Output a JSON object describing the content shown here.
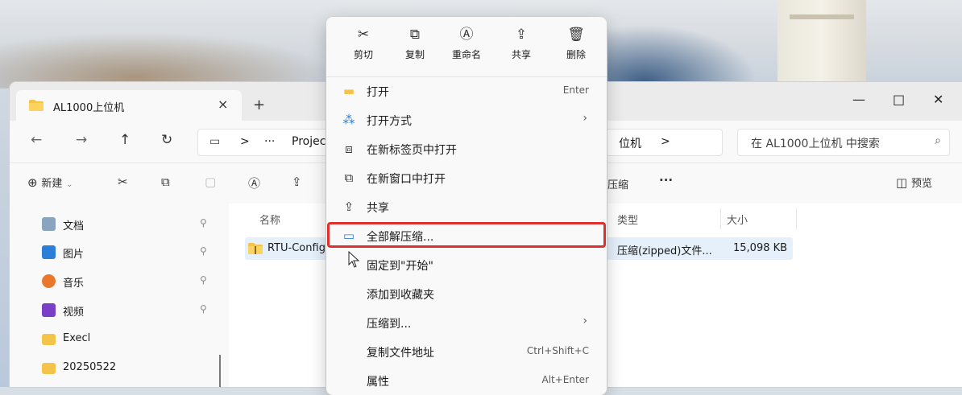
{
  "window": {
    "tab_title": "AL1000上位机",
    "tab_close": "×",
    "tab_add": "+",
    "minimize": "—",
    "maximize": "□",
    "close": "✕"
  },
  "address": {
    "back": "←",
    "forward": "→",
    "up": "↑",
    "refresh": "↻",
    "monitor": "▭",
    "sep": ">",
    "ellipsis": "···",
    "path_part1": "Projec",
    "path_part2": "位机",
    "path_sep2": ">",
    "search_placeholder": "在 AL1000上位机 中搜索",
    "search_icon": "⌕"
  },
  "toolbar": {
    "new_icon": "⊕",
    "new_label": "新建",
    "new_chevron": "⌄",
    "cut_icon": "✂",
    "copy_icon": "⧉",
    "paste_icon": "▢",
    "rename_icon": "Ⓐ",
    "share_icon": "⇪",
    "compress_label": "压缩",
    "more": "···",
    "preview_icon": "◫",
    "preview_label": "预览"
  },
  "sidebar": {
    "items": [
      {
        "label": "文档",
        "pin": "⚲"
      },
      {
        "label": "图片",
        "pin": "⚲"
      },
      {
        "label": "音乐",
        "pin": "⚲"
      },
      {
        "label": "视频",
        "pin": "⚲"
      },
      {
        "label": "Execl"
      },
      {
        "label": "20250522"
      }
    ]
  },
  "content": {
    "col_name": "名称",
    "col_type": "类型",
    "col_size": "大小",
    "file_name": "RTU-Config",
    "file_type": "压缩(zipped)文件...",
    "file_size": "15,098 KB"
  },
  "context_menu": {
    "quick_actions": [
      {
        "icon": "✂",
        "label": "剪切"
      },
      {
        "icon": "⧉",
        "label": "复制"
      },
      {
        "icon": "Ⓐ",
        "label": "重命名"
      },
      {
        "icon": "⇪",
        "label": "共享"
      },
      {
        "icon": "🗑",
        "label": "删除"
      }
    ],
    "items": [
      {
        "icon": "▬",
        "label": "打开",
        "shortcut": "Enter"
      },
      {
        "icon": "⁂",
        "label": "打开方式",
        "arrow": "›"
      },
      {
        "icon": "⧈",
        "label": "在新标签页中打开"
      },
      {
        "icon": "⧉",
        "label": "在新窗口中打开"
      },
      {
        "icon": "⇪",
        "label": "共享"
      },
      {
        "icon": "▭",
        "label": "全部解压缩..."
      },
      {
        "icon": "",
        "label": "固定到\"开始\""
      },
      {
        "icon": "",
        "label": "添加到收藏夹"
      },
      {
        "icon": "",
        "label": "压缩到...",
        "arrow": "›"
      },
      {
        "icon": "",
        "label": "复制文件地址",
        "shortcut": "Ctrl+Shift+C"
      },
      {
        "icon": "",
        "label": "属性",
        "shortcut": "Alt+Enter"
      }
    ]
  },
  "colors": {
    "highlight_border": "#e0302c",
    "folder_yellow": "#f4c34a",
    "selected_row": "#e5f0fb"
  }
}
